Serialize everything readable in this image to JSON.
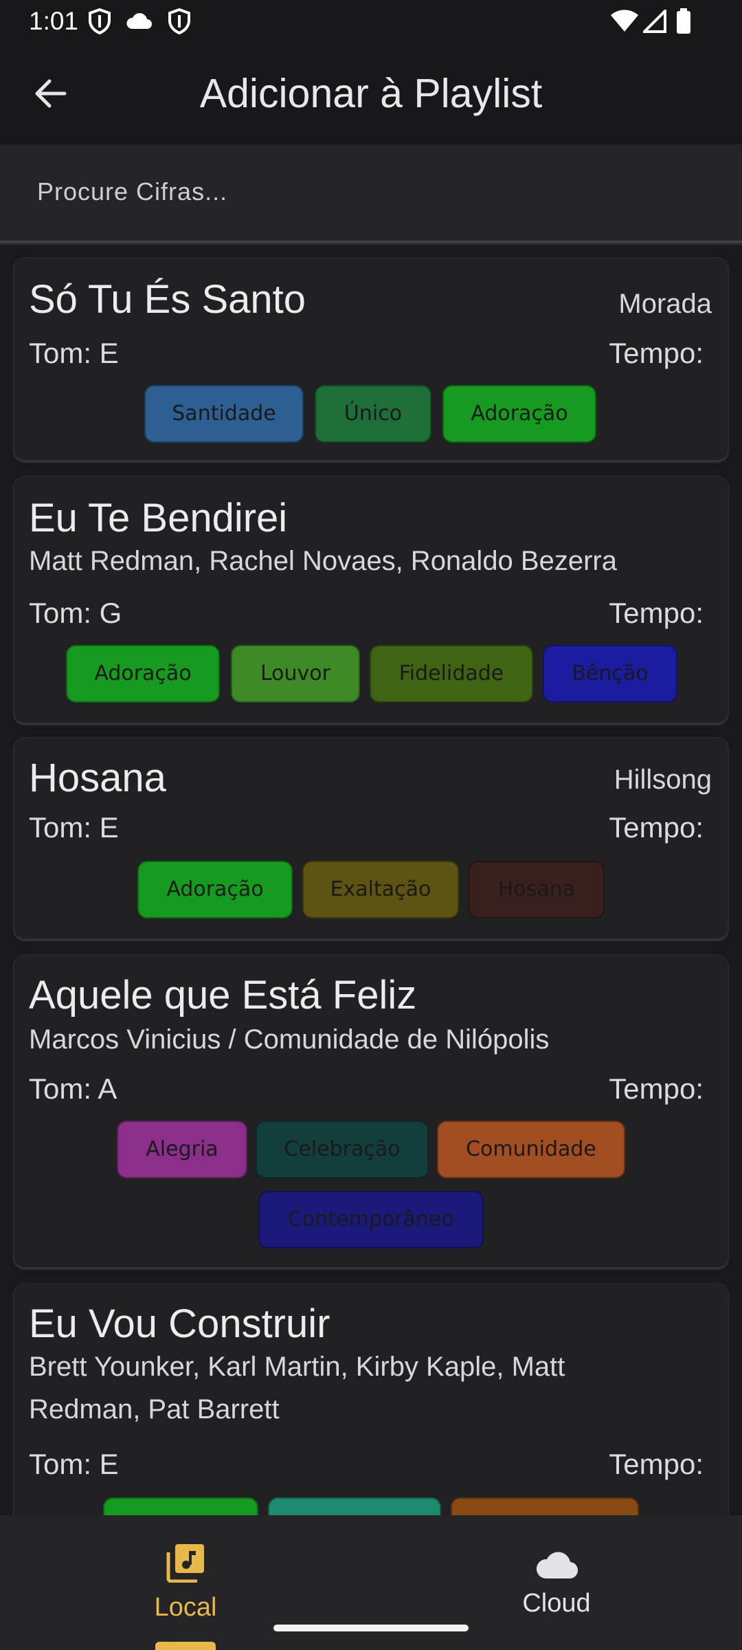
{
  "status": {
    "time": "1:01"
  },
  "appbar": {
    "title": "Adicionar à Playlist"
  },
  "search": {
    "placeholder": "Procure Cifras..."
  },
  "songs": [
    {
      "title": "Só Tu És Santo",
      "artist": "Morada",
      "tom": "Tom: E",
      "tempo": "Tempo:",
      "tags": [
        {
          "label": "Santidade",
          "color": "#2d5f92"
        },
        {
          "label": "Único",
          "color": "#1e6e37"
        },
        {
          "label": "Adoração",
          "color": "#169a1f"
        }
      ]
    },
    {
      "title": "Eu Te Bendirei",
      "artist": "Matt Redman, Rachel Novaes, Ronaldo Bezerra",
      "tom": "Tom: G",
      "tempo": "Tempo:",
      "tags": [
        {
          "label": "Adoração",
          "color": "#169a1f"
        },
        {
          "label": "Louvor",
          "color": "#3e8a26"
        },
        {
          "label": "Fidelidade",
          "color": "#3f6514"
        },
        {
          "label": "Bênção",
          "color": "#1c1ca0"
        }
      ]
    },
    {
      "title": "Hosana",
      "artist": "Hillsong",
      "tom": "Tom: E",
      "tempo": "Tempo:",
      "tags": [
        {
          "label": "Adoração",
          "color": "#169a1f"
        },
        {
          "label": "Exaltação",
          "color": "#5c5410"
        },
        {
          "label": "Hosana",
          "color": "#3a1f1f"
        }
      ]
    },
    {
      "title": "Aquele que Está Feliz",
      "artist": "Marcos Vinicius / Comunidade de Nilópolis",
      "tom": "Tom: A",
      "tempo": "Tempo:",
      "tags": [
        {
          "label": "Alegria",
          "color": "#8c2f8b"
        },
        {
          "label": "Celebração",
          "color": "#123f3c"
        },
        {
          "label": "Comunidade",
          "color": "#a24d22"
        },
        {
          "label": "Contemporâneo",
          "color": "#1b1a7a"
        }
      ]
    },
    {
      "title": "Eu Vou Construir",
      "artist_line1": "Brett Younker, Karl Martin, Kirby Kaple, Matt",
      "artist_line2": "Redman, Pat Barrett",
      "tom": "Tom: E",
      "tempo": "Tempo:",
      "tags": [
        {
          "label": "",
          "color": "#169a1f"
        },
        {
          "label": "",
          "color": "#1e8a6e"
        },
        {
          "label": "",
          "color": "#8a4a16"
        }
      ]
    }
  ],
  "nav": {
    "local_label": "Local",
    "cloud_label": "Cloud",
    "active_color": "#e9b84a"
  }
}
